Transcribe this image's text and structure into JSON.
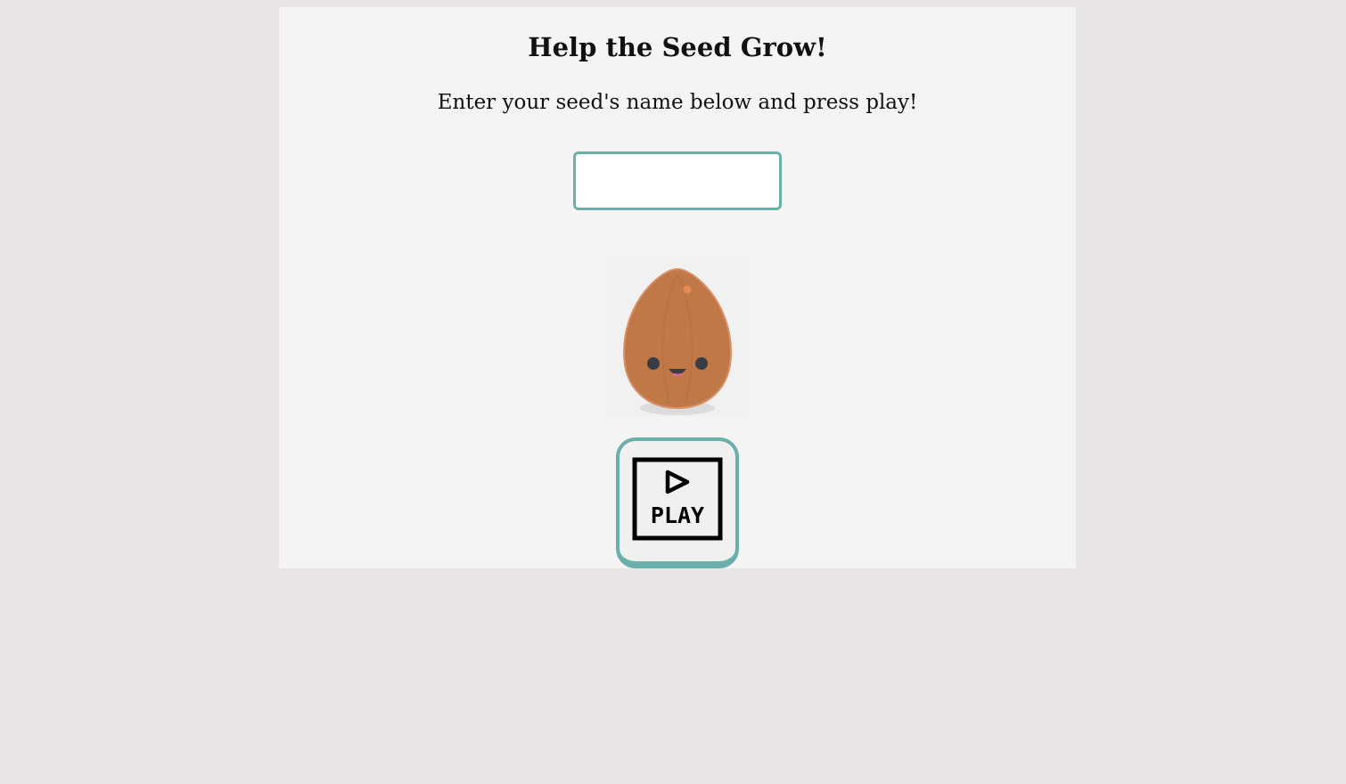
{
  "page": {
    "title": "Help the Seed Grow!",
    "subtitle": "Enter your seed's name below and press play!"
  },
  "name_input": {
    "value": "",
    "placeholder": ""
  },
  "seed": {
    "icon": "seed-character-icon",
    "colors": {
      "body": "#c17847",
      "outline": "#d89066",
      "eyes": "#3a3d44",
      "tongue": "#e0609a",
      "highlight": "#e88a4f"
    }
  },
  "play_button": {
    "label": "PLAY",
    "icon": "play-icon"
  },
  "colors": {
    "background": "#e9e5e4",
    "panel": "#f4f4f4",
    "accent": "#6aafac"
  }
}
